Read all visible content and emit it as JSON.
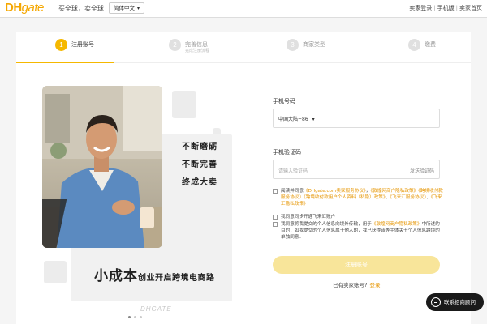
{
  "header": {
    "logo_main": "DH",
    "logo_script": "gate",
    "tagline": "买全球，卖全球",
    "language": "简体中文",
    "links": [
      "卖家登录",
      "手机版",
      "卖家首页"
    ]
  },
  "steps": [
    {
      "num": "1",
      "label": "注册账号",
      "sub": ""
    },
    {
      "num": "2",
      "label": "完善信息",
      "sub": "完成注册流程"
    },
    {
      "num": "3",
      "label": "商家类型",
      "sub": ""
    },
    {
      "num": "4",
      "label": "缴费",
      "sub": ""
    }
  ],
  "banner": {
    "slogans": [
      "不断磨砺",
      "不断完善",
      "终成大卖"
    ],
    "big": "小成本",
    "small": "创业开启跨境电商路",
    "watermark": "DHGATE"
  },
  "form": {
    "phone_label": "手机号码",
    "country_code": "中国大陆+86",
    "code_label": "手机验证码",
    "code_placeholder": "请输入验证码",
    "get_code": "发送验证码",
    "agree1_pre": "阅读并同意",
    "agree1_l1": "《DHgate.com卖家服务协议》",
    "agree1_l2": "《敦煌网商户隐私政策》",
    "agree1_l3": "《跨境收付款服务协议》",
    "agree1_l4": "《跨境收付款用户个人资料（私隐）政策》",
    "agree1_l5": "《飞来汇服务协议》",
    "agree1_l6": "《飞来汇隐私政策》",
    "agree2": "我同意同步开通飞来汇账户",
    "agree3_pre": "我同意将我提交的个人信息向境外传输，用于",
    "agree3_link": "《敦煌网商户隐私政策》",
    "agree3_post": "中所述的目的，如我提交的个人信息属于他人的，我已获得该等主体关于个人信息跨境的单独同意。",
    "submit": "注册账号",
    "already": "已有卖家账号?",
    "login": "登录"
  },
  "chat": {
    "label": "联系招商顾问"
  },
  "colors": {
    "accent": "#f5b800",
    "link": "#e69500",
    "submit_disabled": "#f8e59a"
  }
}
